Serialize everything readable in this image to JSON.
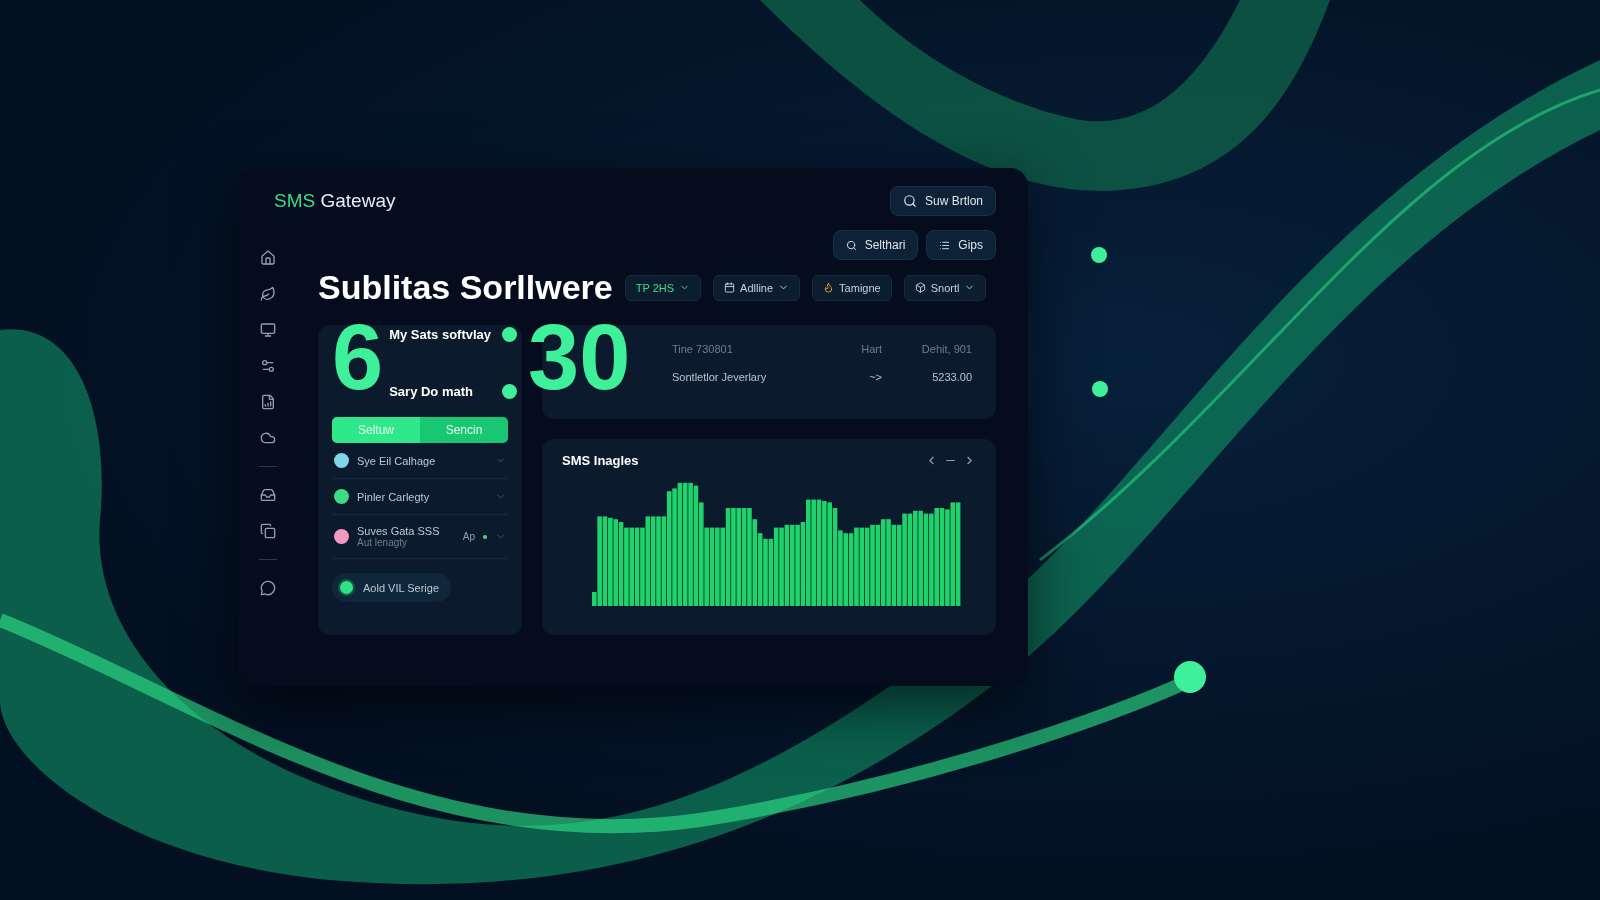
{
  "app": {
    "brand_accent": "SMS",
    "brand_rest": "Gateway"
  },
  "header_button": {
    "label": "Suw Brtlon"
  },
  "toolbar_buttons": [
    {
      "label": "Selthari",
      "kind": "search"
    },
    {
      "label": "Gips",
      "kind": "list"
    }
  ],
  "title": "Sublitas Sorllwere",
  "filters": [
    {
      "label": "TP 2HS",
      "kind": "accent",
      "dropdown": true
    },
    {
      "label": "Adlline",
      "kind": "calendar",
      "dropdown": true
    },
    {
      "label": "Tamigne",
      "kind": "warning",
      "dropdown": false
    },
    {
      "label": "Snortl",
      "kind": "box",
      "dropdown": true
    }
  ],
  "time": {
    "hours": "6",
    "minutes": "30",
    "label_top": "My Sats softvlay",
    "label_bottom": "Sary Do math"
  },
  "segments": [
    {
      "label": "Seltuw",
      "selected": true
    },
    {
      "label": "Sencin",
      "selected": false
    }
  ],
  "list_items": [
    {
      "title": "Sye Eil Calhage",
      "color": "#7fd6e8"
    },
    {
      "title": "Pinler Carlegty",
      "color": "#3ddc84"
    },
    {
      "title": "Suves Gata SSS",
      "subtitle": "Aut lenagty",
      "value": "Ap",
      "color": "#f49ac1"
    }
  ],
  "footer_button": {
    "label": "Aold VIL Serige"
  },
  "info_table": {
    "header": [
      "Tine 730801",
      "Hart",
      "Dehit, 901"
    ],
    "row": [
      "Sontletlor Jeverlary",
      "~>",
      "5233.00"
    ]
  },
  "chart_card": {
    "title": "SMS Inagles"
  }
}
